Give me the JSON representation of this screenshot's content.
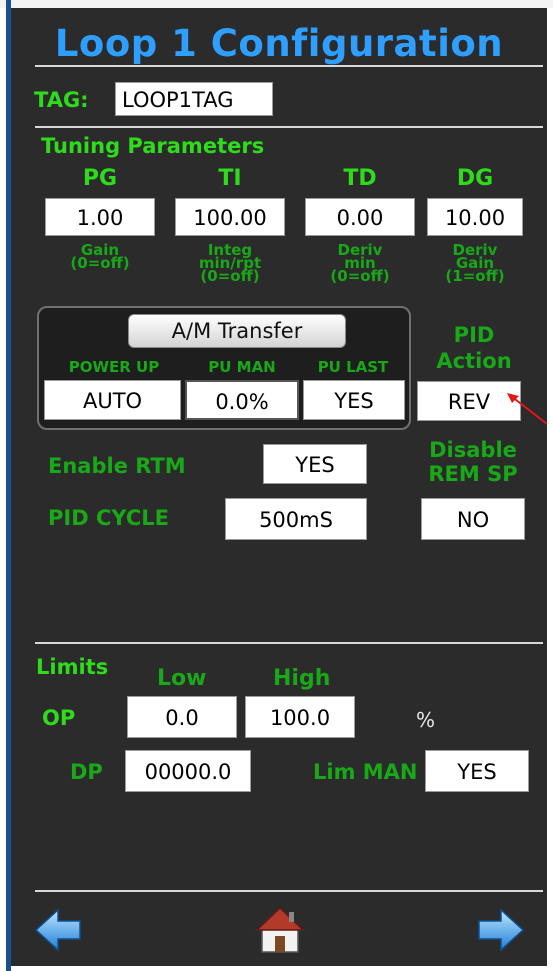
{
  "title": "Loop 1 Configuration",
  "tag": {
    "label": "TAG:",
    "value": "LOOP1TAG"
  },
  "tuning": {
    "heading": "Tuning Parameters",
    "params": [
      {
        "name": "PG",
        "value": "1.00",
        "desc1": "Gain",
        "desc2": "(0=off)",
        "desc3": ""
      },
      {
        "name": "TI",
        "value": "100.00",
        "desc1": "Integ",
        "desc2": "min/rpt",
        "desc3": "(0=off)"
      },
      {
        "name": "TD",
        "value": "0.00",
        "desc1": "Deriv",
        "desc2": "min",
        "desc3": "(0=off)"
      },
      {
        "name": "DG",
        "value": "10.00",
        "desc1": "Deriv",
        "desc2": "Gain",
        "desc3": "(1=off)"
      }
    ]
  },
  "am_transfer": {
    "button_label": "A/M Transfer",
    "power_up_label": "POWER UP",
    "power_up_value": "AUTO",
    "pu_man_label": "PU MAN",
    "pu_man_value": "0.0%",
    "pu_last_label": "PU LAST",
    "pu_last_value": "YES"
  },
  "pid_action": {
    "label_line1": "PID",
    "label_line2": "Action",
    "value": "REV"
  },
  "enable_rtm": {
    "label": "Enable RTM",
    "value": "YES"
  },
  "disable_rem_sp": {
    "label_line1": "Disable",
    "label_line2": "REM SP",
    "value": "NO"
  },
  "pid_cycle": {
    "label": "PID CYCLE",
    "value": "500mS"
  },
  "limits": {
    "heading": "Limits",
    "low_label": "Low",
    "high_label": "High",
    "op_label": "OP",
    "op_low": "0.0",
    "op_high": "100.0",
    "op_unit": "%",
    "dp_label": "DP",
    "dp_value": "00000.0",
    "lim_man_label": "Lim MAN",
    "lim_man_value": "YES"
  },
  "nav": {
    "back_icon": "left-arrow-icon",
    "home_icon": "home-icon",
    "forward_icon": "right-arrow-icon"
  },
  "colors": {
    "title_blue": "#2f9fff",
    "label_green": "#2edc1c",
    "sub_green": "#18a818",
    "background": "#2b2b2b",
    "annotation_red": "#e01818"
  }
}
